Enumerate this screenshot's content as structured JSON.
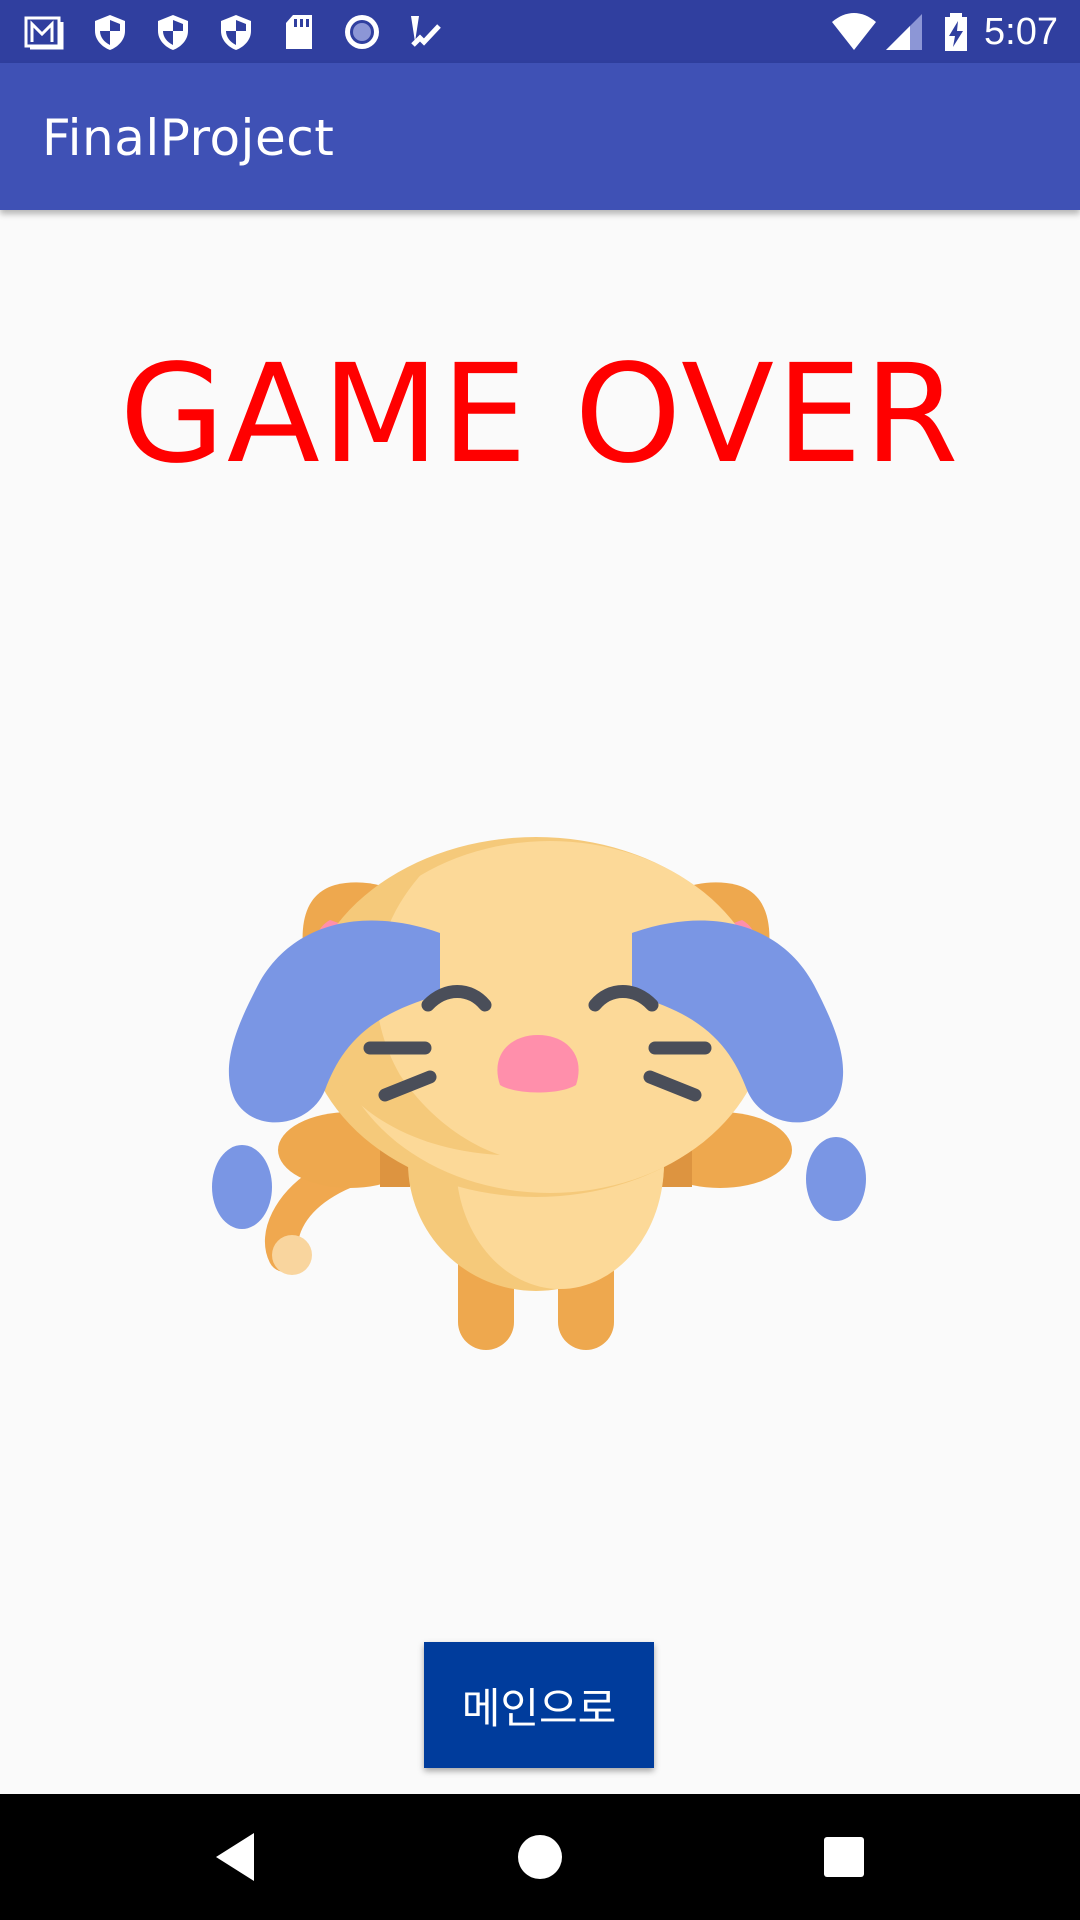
{
  "status_bar": {
    "time": "5:07",
    "left_icons": [
      "gmail-icon",
      "shield-icon",
      "shield-icon",
      "shield-icon",
      "sd-card-icon",
      "record-icon",
      "check-icon"
    ],
    "right_icons": [
      "wifi-icon",
      "cell-signal-icon",
      "battery-charging-icon"
    ],
    "color": "#303f9f"
  },
  "app_bar": {
    "title": "FinalProject",
    "color": "#3f51b5"
  },
  "main": {
    "headline": "GAME OVER",
    "headline_color": "#ff0000",
    "illustration": "crying-cat-icon",
    "button_label": "메인으로",
    "button_color": "#003c9c"
  },
  "nav_bar": {
    "buttons": [
      "back-icon",
      "home-icon",
      "recents-icon"
    ]
  }
}
